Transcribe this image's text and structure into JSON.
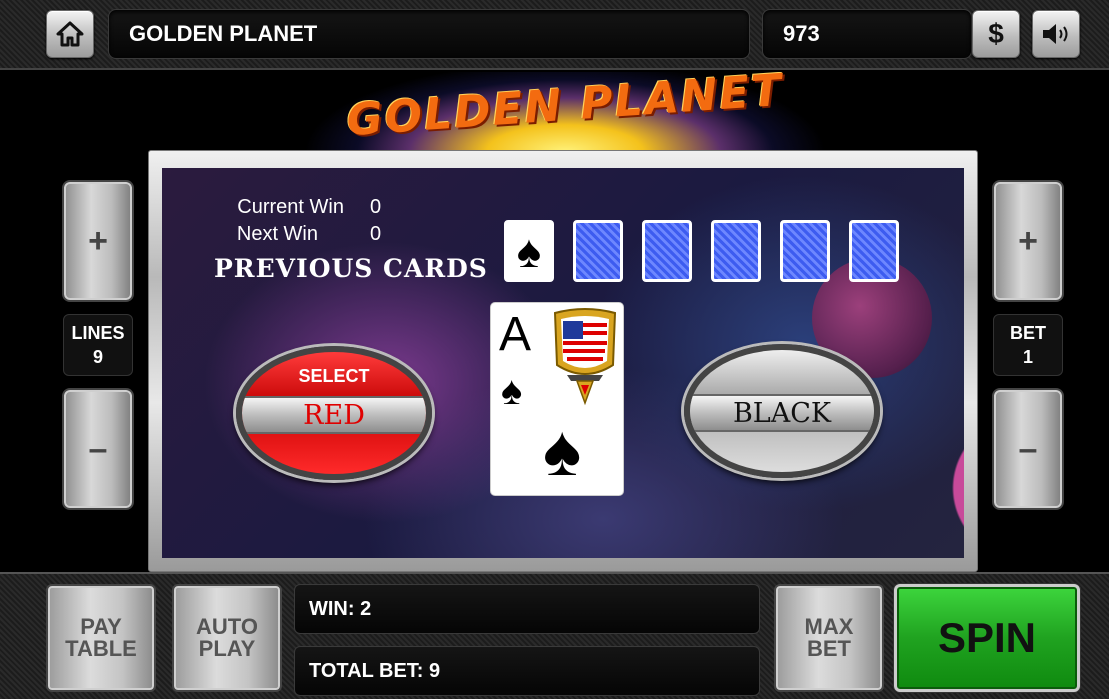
{
  "header": {
    "title": "GOLDEN PLANET",
    "credits": "973",
    "home_icon": "home-icon",
    "cashier_label": "$",
    "sound_icon": "speaker-icon"
  },
  "logo": {
    "text": "GOLDEN PLANET"
  },
  "gamble": {
    "current_win_label": "Current Win",
    "current_win_value": "0",
    "next_win_label": "Next Win",
    "next_win_value": "0",
    "previous_cards_title": "PREVIOUS CARDS",
    "previous_cards": [
      "spade",
      "back",
      "back",
      "back",
      "back",
      "back"
    ],
    "current_card": {
      "rank": "A",
      "suit": "♠"
    },
    "select_label": "SELECT",
    "red_label": "RED",
    "black_label": "BLACK"
  },
  "side": {
    "lines_label": "LINES",
    "lines_value": "9",
    "bet_label": "BET",
    "bet_value": "1",
    "plus": "+",
    "minus": "–"
  },
  "footer": {
    "paytable_line1": "PAY",
    "paytable_line2": "TABLE",
    "autoplay_line1": "AUTO",
    "autoplay_line2": "PLAY",
    "win_text": "WIN:  2",
    "totalbet_text": "TOTAL BET:  9",
    "maxbet_line1": "MAX",
    "maxbet_line2": "BET",
    "spin_label": "SPIN"
  },
  "colors": {
    "red_button": "#d40a0a",
    "spin_green": "#20a320",
    "card_back_blue": "#4466ee"
  }
}
